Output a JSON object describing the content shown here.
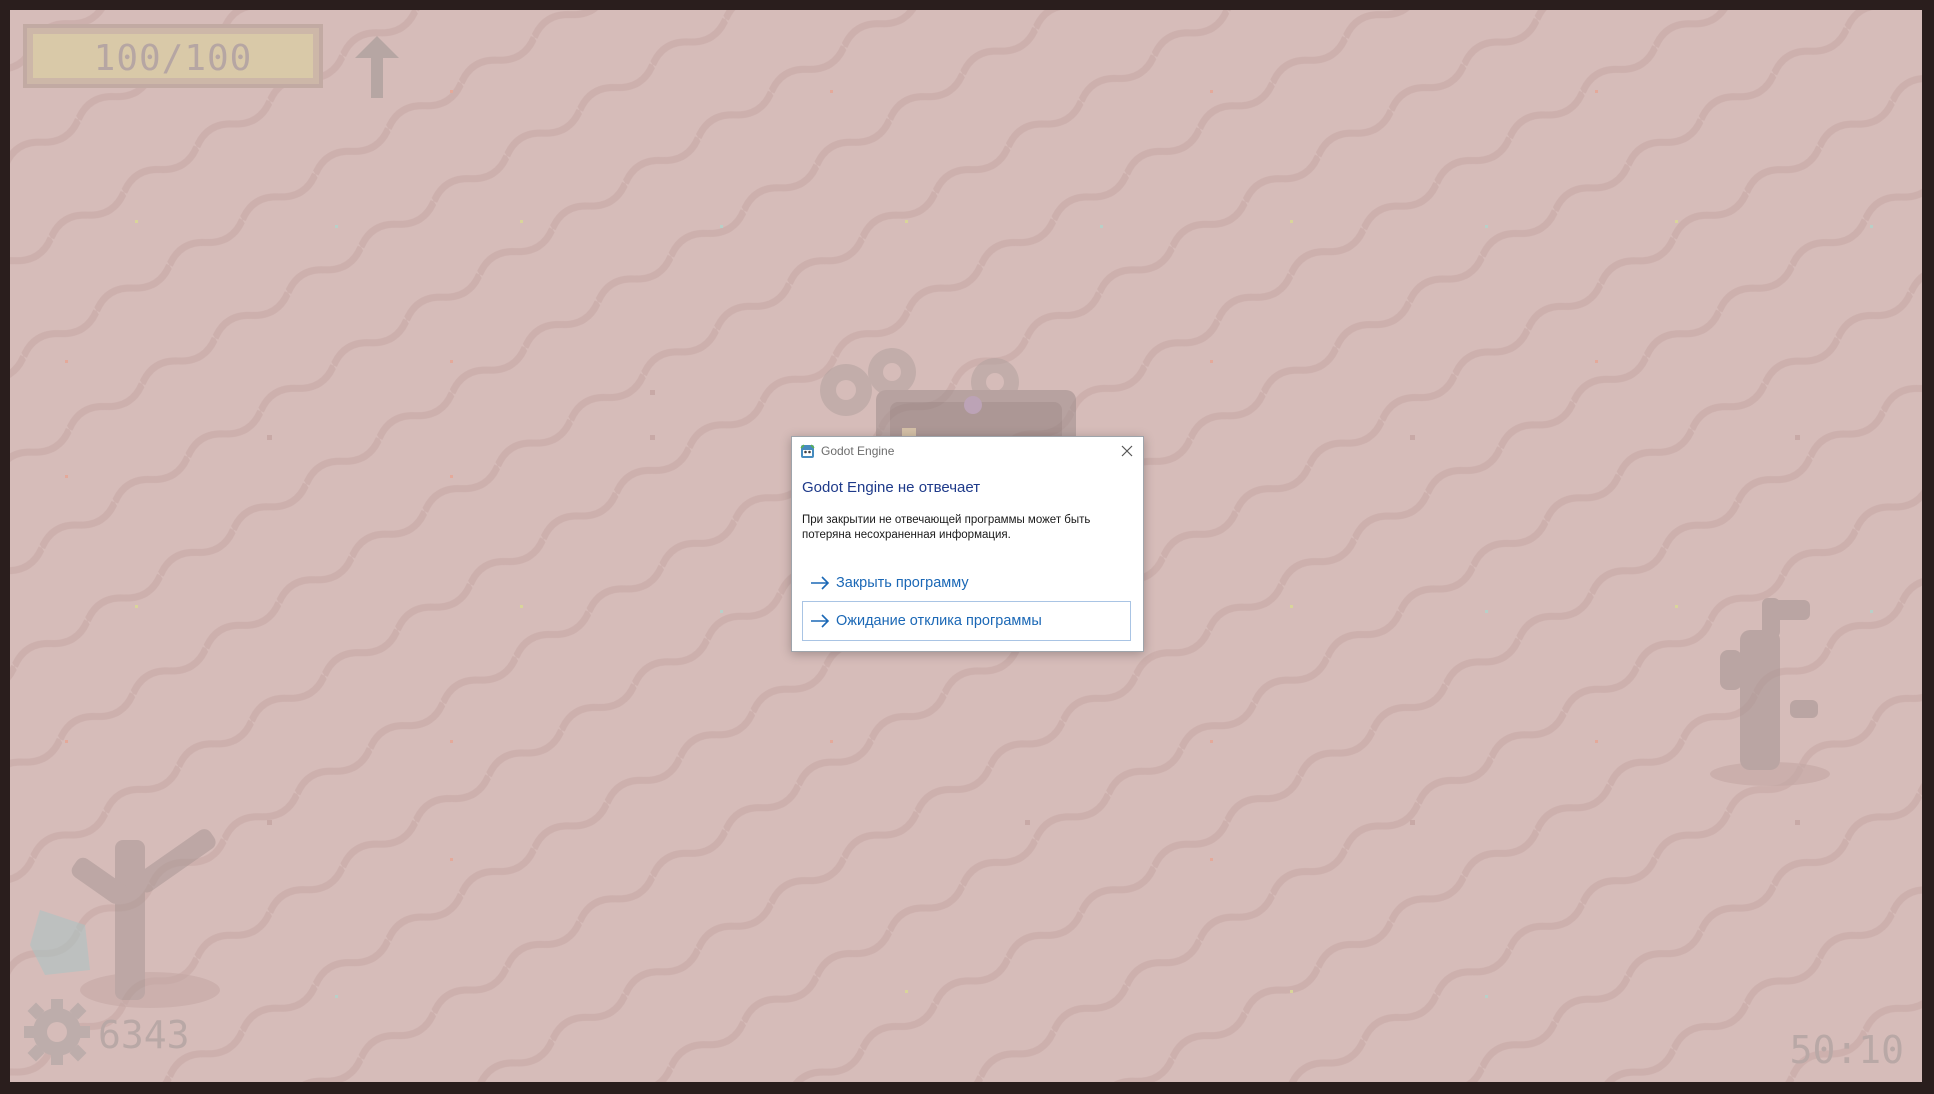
{
  "hud": {
    "health_text": "100/100",
    "health_fraction": 1.0,
    "gear_count": "6343",
    "timer": "50:10",
    "icons": [
      "upgrade-arrow-icon",
      "gear-icon"
    ]
  },
  "dialog": {
    "title": "Godot Engine",
    "heading": "Godot Engine не отвечает",
    "message": "При закрытии не отвечающей программы может быть потеряна несохраненная информация.",
    "options": [
      {
        "label": "Закрыть программу"
      },
      {
        "label": "Ожидание отклика программы"
      }
    ]
  },
  "colors": {
    "ground": "#d6bcb9",
    "dialog_heading": "#1e3a8a",
    "option_link": "#1b68b6",
    "focus_border": "#a9c4e4"
  }
}
